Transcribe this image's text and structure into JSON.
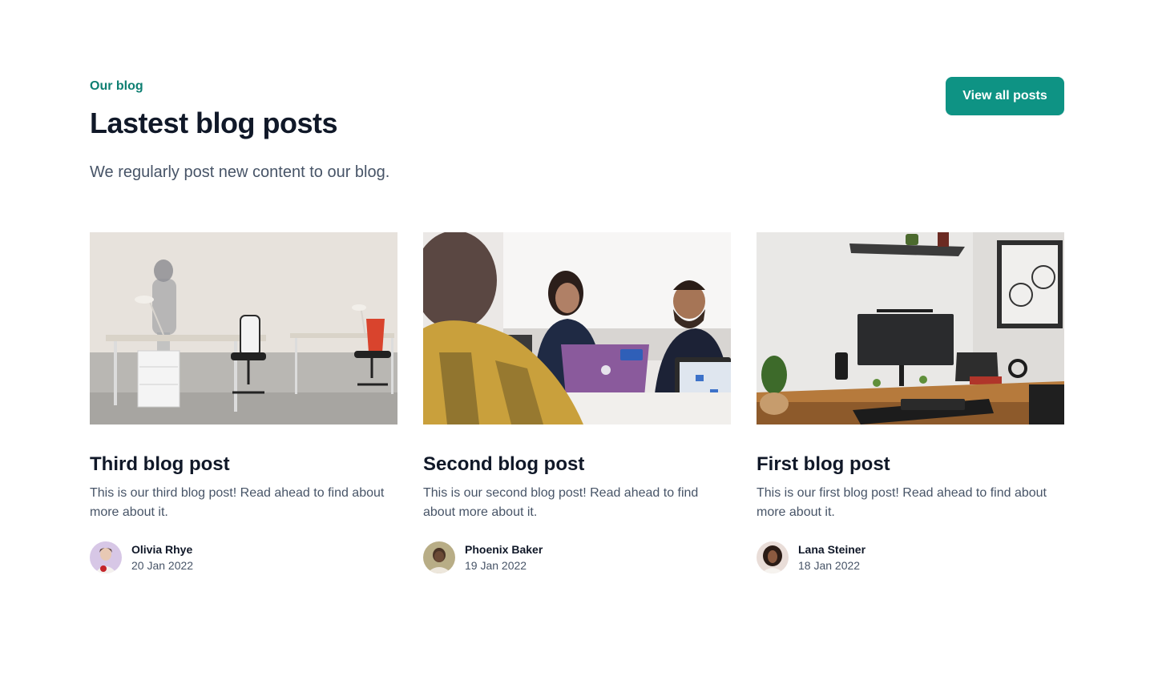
{
  "header": {
    "eyebrow": "Our blog",
    "title": "Lastest blog posts",
    "subtitle": "We regularly post new content to our blog.",
    "view_all_label": "View all posts"
  },
  "colors": {
    "accent": "#0e9384",
    "eyebrow": "#0e7f72",
    "heading": "#101828",
    "body": "#475467"
  },
  "posts": [
    {
      "title": "Third blog post",
      "description": "This is our third blog post! Read ahead to find about more about it.",
      "image": "office-desks-photo",
      "author": {
        "name": "Olivia Rhye",
        "date": "20 Jan 2022",
        "avatar": "avatar-olivia"
      }
    },
    {
      "title": "Second blog post",
      "description": "This is our second blog post! Read ahead to find about more about it.",
      "image": "team-meeting-photo",
      "author": {
        "name": "Phoenix Baker",
        "date": "19 Jan 2022",
        "avatar": "avatar-phoenix"
      }
    },
    {
      "title": "First blog post",
      "description": "This is our first blog post! Read ahead to find about more about it.",
      "image": "desk-setup-photo",
      "author": {
        "name": "Lana Steiner",
        "date": "18 Jan 2022",
        "avatar": "avatar-lana"
      }
    }
  ]
}
